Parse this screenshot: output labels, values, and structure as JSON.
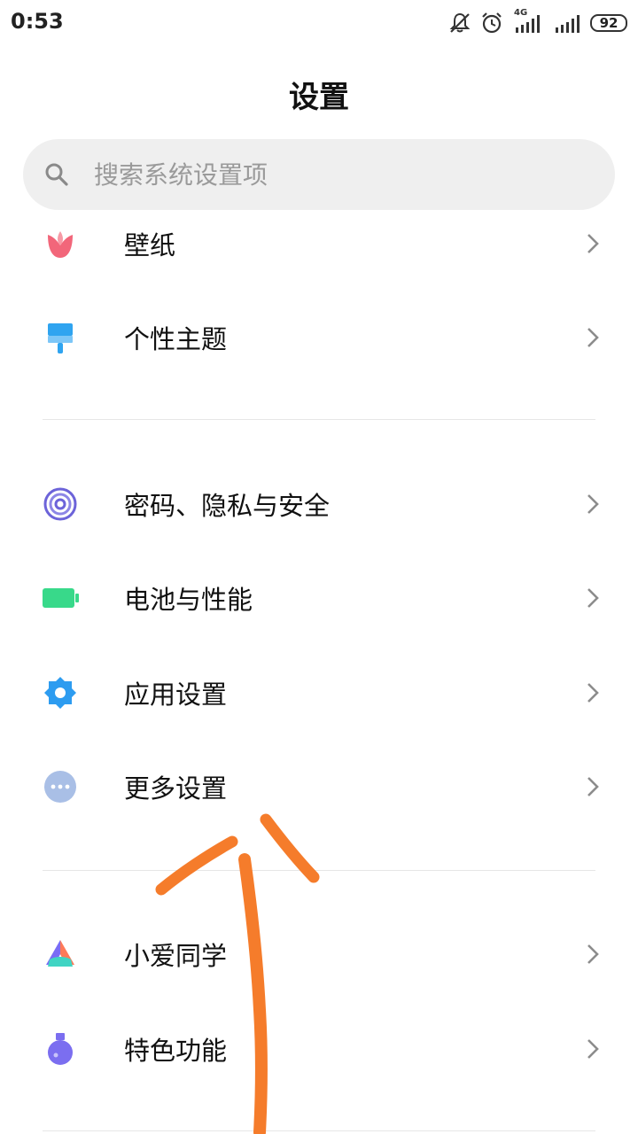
{
  "status_bar": {
    "time": "0:53",
    "network_label": "4G",
    "battery": "92",
    "icons": [
      "mute-icon",
      "alarm-icon",
      "signal-icon",
      "signal-icon-2",
      "battery-icon"
    ]
  },
  "header": {
    "title": "设置"
  },
  "search": {
    "placeholder": "搜索系统设置项",
    "icon": "search-icon"
  },
  "groups": [
    {
      "items": [
        {
          "label": "壁纸",
          "icon": "wallpaper-icon",
          "color": "#f2667a"
        },
        {
          "label": "个性主题",
          "icon": "theme-brush-icon",
          "color": "#2fa4f0"
        }
      ]
    },
    {
      "items": [
        {
          "label": "密码、隐私与安全",
          "icon": "fingerprint-icon",
          "color": "#6c63d9"
        },
        {
          "label": "电池与性能",
          "icon": "battery-performance-icon",
          "color": "#38d98a"
        },
        {
          "label": "应用设置",
          "icon": "app-settings-gear-icon",
          "color": "#2d9cf0"
        },
        {
          "label": "更多设置",
          "icon": "more-settings-icon",
          "color": "#a9bfe6"
        }
      ]
    },
    {
      "items": [
        {
          "label": "小爱同学",
          "icon": "xiaoai-icon",
          "color": "#ff7a59"
        },
        {
          "label": "特色功能",
          "icon": "feature-flask-icon",
          "color": "#7b6ef0"
        }
      ]
    }
  ],
  "annotation": {
    "color": "#f57c2b",
    "icon": "hand-drawn-arrow"
  }
}
